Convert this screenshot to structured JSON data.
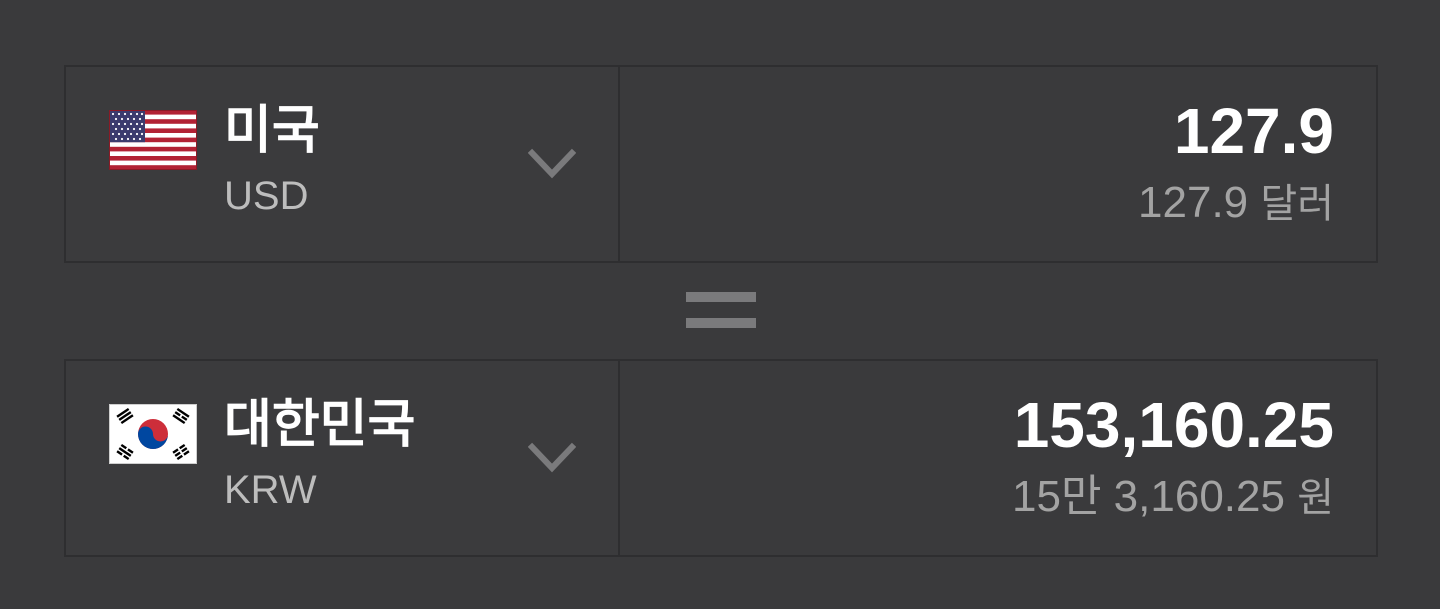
{
  "from": {
    "country_name": "미국",
    "currency_code": "USD",
    "flag_icon": "us-flag-icon",
    "amount": "127.9",
    "amount_words_number": "127.9",
    "amount_words_unit": "달러"
  },
  "operator": {
    "icon": "equals-icon"
  },
  "to": {
    "country_name": "대한민국",
    "currency_code": "KRW",
    "flag_icon": "kr-flag-icon",
    "amount": "153,160.25",
    "amount_words_number": "15만 3,160.25",
    "amount_words_unit": "원"
  },
  "colors": {
    "background": "#3a3a3c",
    "border": "#2e2e30",
    "primary_text": "#ffffff",
    "secondary_text": "#a3a3a3",
    "chevron": "#7a7a7c"
  }
}
